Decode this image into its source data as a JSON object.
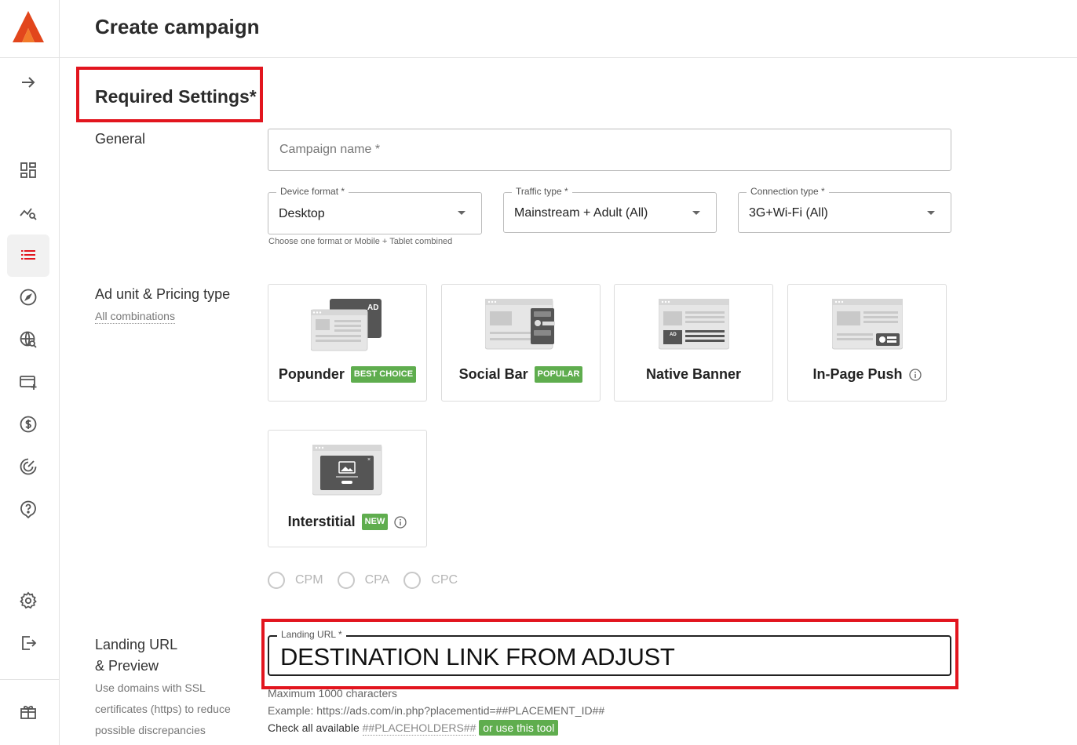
{
  "header": {
    "title": "Create campaign"
  },
  "section": {
    "title": "Required Settings*"
  },
  "general": {
    "label": "General",
    "campaign_name_placeholder": "Campaign name *",
    "device_format": {
      "label": "Device format *",
      "value": "Desktop"
    },
    "traffic_type": {
      "label": "Traffic type *",
      "value": "Mainstream + Adult (All)"
    },
    "connection_type": {
      "label": "Connection type *",
      "value": "3G+Wi-Fi (All)"
    },
    "hint": "Choose one format or Mobile + Tablet combined"
  },
  "ad_unit": {
    "label": "Ad unit & Pricing type",
    "sublabel": "All combinations",
    "cards": [
      {
        "title": "Popunder",
        "badge": "BEST CHOICE",
        "ad_tag": "AD"
      },
      {
        "title": "Social Bar",
        "badge": "POPULAR"
      },
      {
        "title": "Native Banner",
        "ad_tag": "AD"
      },
      {
        "title": "In-Page Push"
      },
      {
        "title": "Interstitial",
        "badge": "NEW"
      }
    ],
    "pricing": [
      "CPM",
      "CPA",
      "CPC"
    ]
  },
  "landing": {
    "label_line1": "Landing URL",
    "label_line2": "& Preview",
    "desc_line1": "Use domains with SSL",
    "desc_line2": "certificates (https) to reduce",
    "desc_line3": "possible discrepancies",
    "field_label": "Landing URL *",
    "value": "DESTINATION LINK FROM ADJUST",
    "max_chars": "Maximum 1000 characters",
    "example": "Example: https://ads.com/in.php?placementid=##PLACEMENT_ID##",
    "check_prefix": "Check all available",
    "placeholders_link": "##PLACEHOLDERS##",
    "tool_button": "or use this tool"
  },
  "colors": {
    "brand": "#e2461c",
    "badge_green": "#5fad4e",
    "highlight_red": "#e2151e"
  },
  "sidebar_icons": [
    "expand-arrow-icon",
    "dashboard-icon",
    "statistics-icon",
    "campaigns-list-icon",
    "compass-icon",
    "search-globe-icon",
    "add-payment-icon",
    "dollar-icon",
    "target-icon",
    "help-icon",
    "settings-icon",
    "logout-icon",
    "gift-icon"
  ]
}
